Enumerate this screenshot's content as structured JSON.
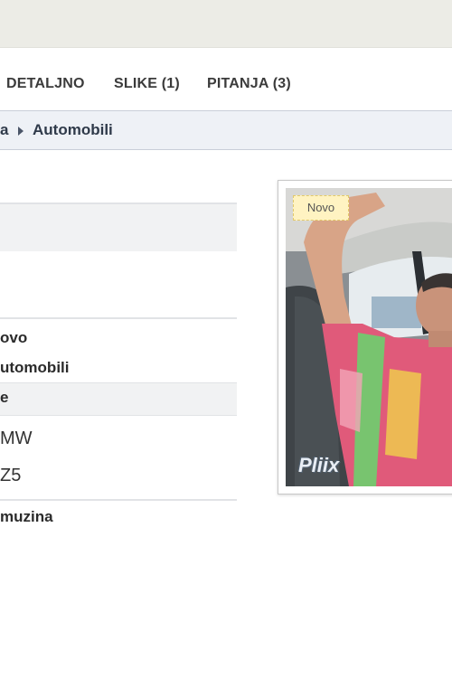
{
  "tabs": [
    "DETALJNO",
    "SLIKE (1)",
    "PITANJA (3)"
  ],
  "breadcrumb": {
    "parent_fragment": "a",
    "current": "Automobili"
  },
  "details": {
    "condition": "ovo",
    "category": "utomobili",
    "section_label": "e",
    "brand": "MW",
    "model": "Z5",
    "body_type": "muzina"
  },
  "photo": {
    "badge": "Novo",
    "watermark": "Pliix"
  }
}
